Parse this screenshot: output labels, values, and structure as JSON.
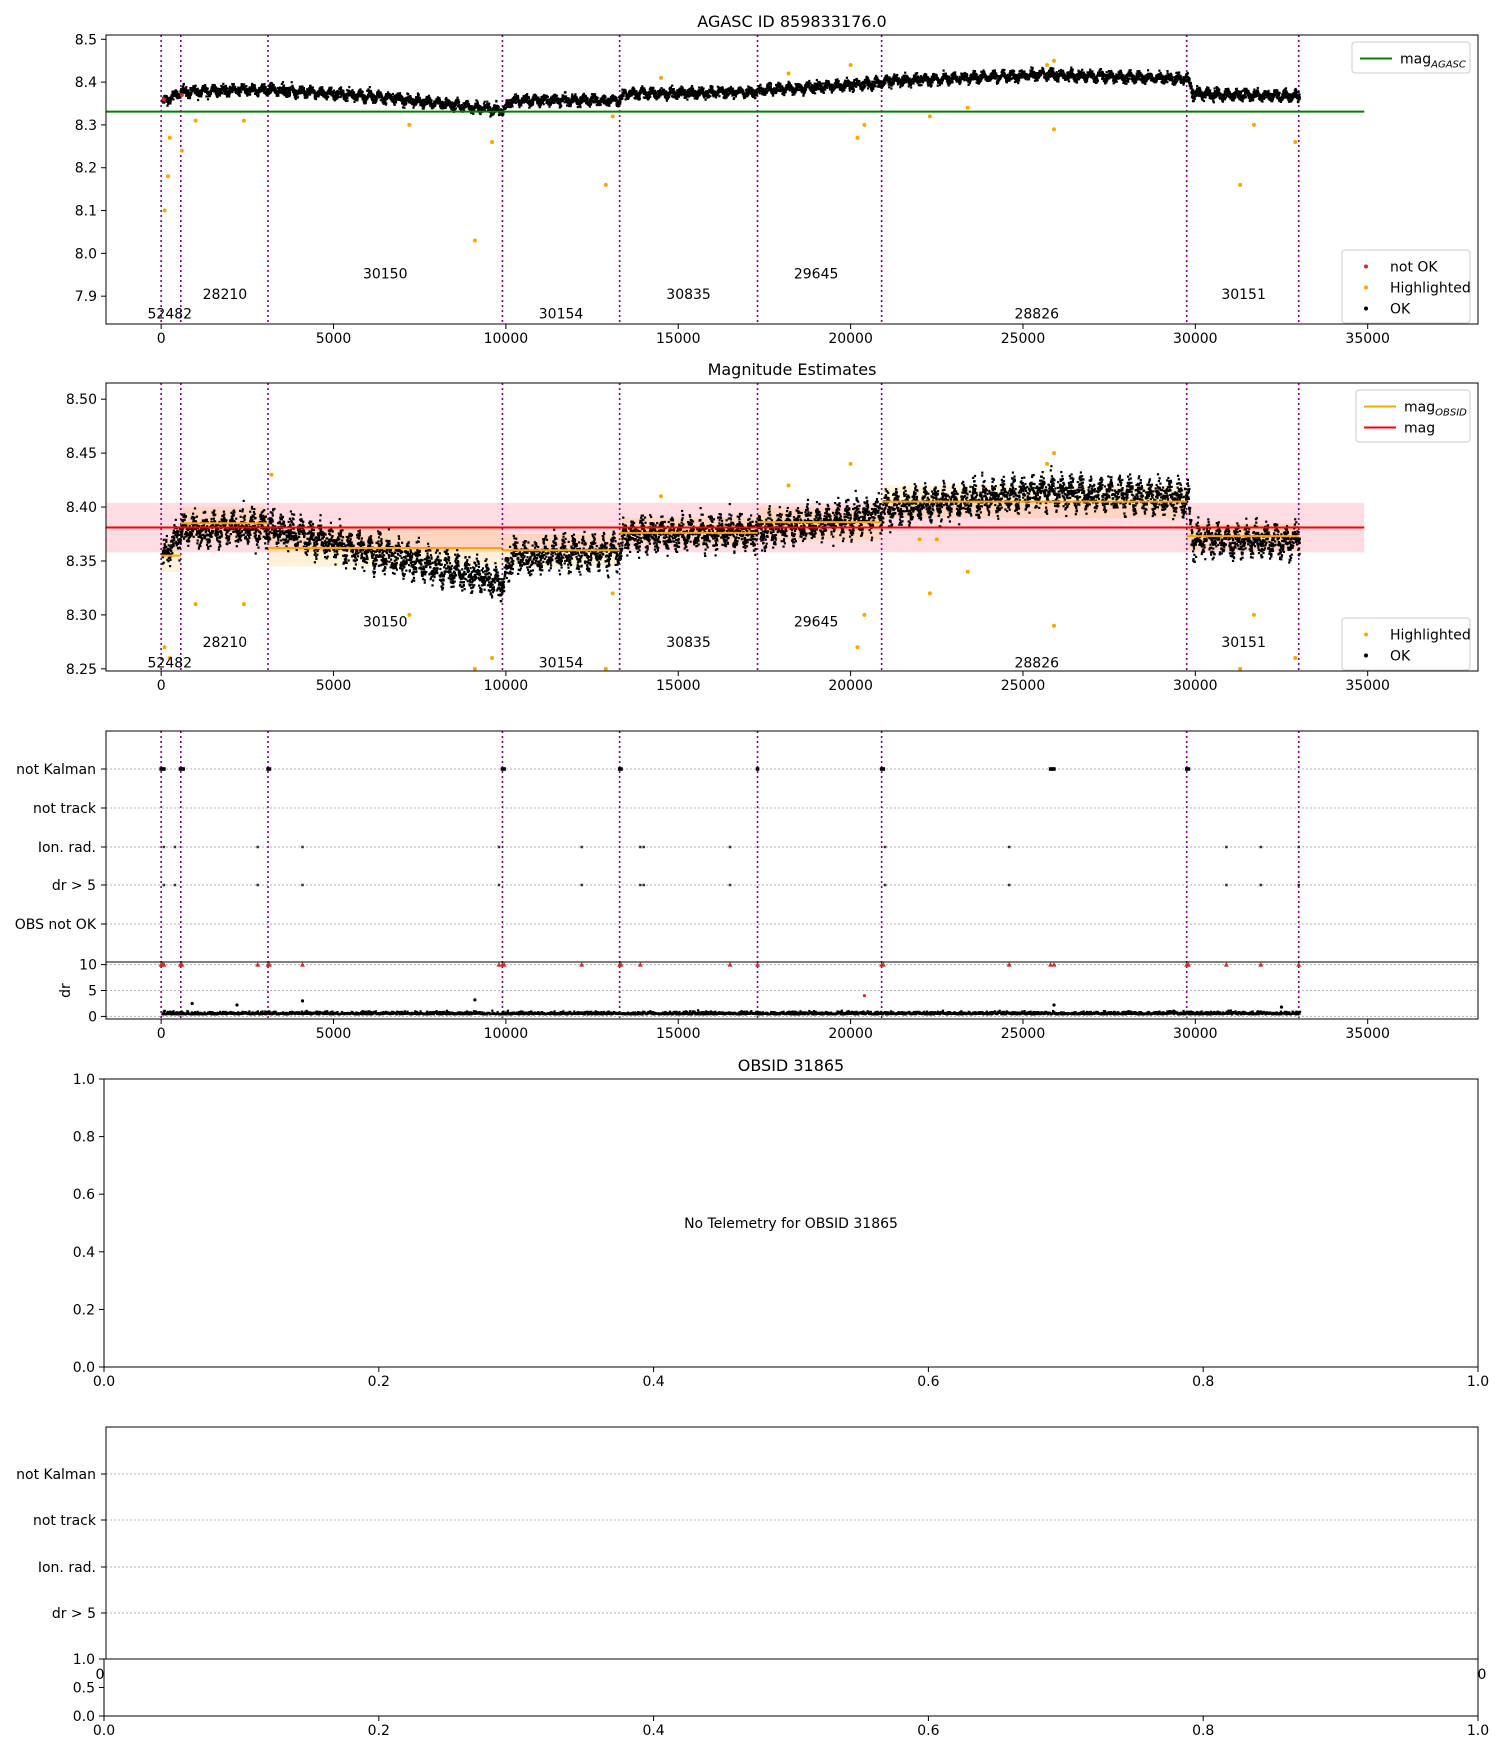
{
  "colors": {
    "ok": "#000000",
    "highlighted": "#ffa500",
    "not_ok": "#d62728",
    "agasc_line": "#008000",
    "mag_line": "#ff0000",
    "obsid_line": "#ffa500",
    "divider": "#800080",
    "band": "#ffc0cb",
    "grid": "#b0b0b0"
  },
  "chart_data": [
    {
      "id": "panel1",
      "type": "scatter",
      "title": "AGASC ID 859833176.0",
      "xlim": [
        -1600,
        38200
      ],
      "ylim": [
        7.835,
        8.51
      ],
      "xticks": [
        0,
        5000,
        10000,
        15000,
        20000,
        25000,
        30000,
        35000
      ],
      "xtick_labels": [
        "0",
        "5000",
        "10000",
        "15000",
        "20000",
        "25000",
        "30000",
        "35000"
      ],
      "yticks": [
        7.9,
        8.0,
        8.1,
        8.2,
        8.3,
        8.4,
        8.5
      ],
      "ytick_labels": [
        "7.9",
        "8.0",
        "8.1",
        "8.2",
        "8.3",
        "8.4",
        "8.5"
      ],
      "legend_top": {
        "position": "top-right",
        "entries": [
          {
            "label": "mag",
            "sub": "AGASC",
            "kind": "line",
            "color_key": "agasc_line"
          }
        ]
      },
      "legend_bottom": {
        "position": "bottom-right",
        "entries": [
          {
            "label": "not OK",
            "kind": "dot",
            "color_key": "not_ok"
          },
          {
            "label": "Highlighted",
            "kind": "dot",
            "color_key": "highlighted"
          },
          {
            "label": "OK",
            "kind": "dot",
            "color_key": "ok"
          }
        ]
      },
      "mag_agasc": 8.331,
      "mag_agasc_xrange": [
        -1600,
        34900
      ],
      "obs_boundaries": [
        0,
        570,
        3100,
        9900,
        13300,
        17300,
        20900,
        29750,
        33000
      ],
      "obs_labels": [
        {
          "text": "52482",
          "x": 250,
          "y": 7.86
        },
        {
          "text": "28210",
          "x": 1850,
          "y": 7.905
        },
        {
          "text": "30150",
          "x": 6500,
          "y": 7.953
        },
        {
          "text": "30154",
          "x": 11600,
          "y": 7.86
        },
        {
          "text": "30835",
          "x": 15300,
          "y": 7.905
        },
        {
          "text": "29645",
          "x": 19000,
          "y": 7.953
        },
        {
          "text": "28826",
          "x": 25400,
          "y": 7.86
        },
        {
          "text": "30151",
          "x": 31400,
          "y": 7.905
        }
      ],
      "trend": [
        [
          0,
          8.355
        ],
        [
          570,
          8.38
        ],
        [
          3100,
          8.385
        ],
        [
          6000,
          8.37
        ],
        [
          9500,
          8.34
        ],
        [
          9900,
          8.335
        ],
        [
          10100,
          8.36
        ],
        [
          13300,
          8.36
        ],
        [
          13400,
          8.375
        ],
        [
          17300,
          8.38
        ],
        [
          17500,
          8.385
        ],
        [
          20900,
          8.4
        ],
        [
          21000,
          8.405
        ],
        [
          25500,
          8.42
        ],
        [
          29750,
          8.41
        ],
        [
          29900,
          8.375
        ],
        [
          33000,
          8.37
        ]
      ],
      "highlighted_points": [
        [
          100,
          8.1
        ],
        [
          200,
          8.18
        ],
        [
          250,
          8.27
        ],
        [
          600,
          8.24
        ],
        [
          1000,
          8.31
        ],
        [
          2400,
          8.31
        ],
        [
          7200,
          8.3
        ],
        [
          9100,
          8.03
        ],
        [
          9600,
          8.26
        ],
        [
          12900,
          8.16
        ],
        [
          13100,
          8.32
        ],
        [
          20200,
          8.27
        ],
        [
          20400,
          8.3
        ],
        [
          22300,
          8.32
        ],
        [
          23400,
          8.34
        ],
        [
          25900,
          8.29
        ],
        [
          31300,
          8.16
        ],
        [
          31700,
          8.3
        ],
        [
          32900,
          8.26
        ],
        [
          25900,
          8.45
        ],
        [
          25700,
          8.44
        ],
        [
          20000,
          8.44
        ],
        [
          14500,
          8.41
        ],
        [
          18200,
          8.42
        ]
      ],
      "not_ok_points": [
        [
          80,
          8.36
        ],
        [
          600,
          8.37
        ]
      ],
      "spread": 0.018
    },
    {
      "id": "panel2",
      "type": "scatter",
      "title": "Magnitude Estimates",
      "xlim": [
        -1600,
        38200
      ],
      "ylim": [
        8.248,
        8.515
      ],
      "xticks": [
        0,
        5000,
        10000,
        15000,
        20000,
        25000,
        30000,
        35000
      ],
      "xtick_labels": [
        "0",
        "5000",
        "10000",
        "15000",
        "20000",
        "25000",
        "30000",
        "35000"
      ],
      "yticks": [
        8.25,
        8.3,
        8.35,
        8.4,
        8.45,
        8.5
      ],
      "ytick_labels": [
        "8.25",
        "8.30",
        "8.35",
        "8.40",
        "8.45",
        "8.50"
      ],
      "legend_top": {
        "position": "top-right",
        "entries": [
          {
            "label": "mag",
            "sub": "OBSID",
            "kind": "line",
            "color_key": "obsid_line"
          },
          {
            "label": "mag",
            "sub": "",
            "kind": "line",
            "color_key": "mag_line"
          }
        ]
      },
      "legend_bottom": {
        "position": "bottom-right",
        "entries": [
          {
            "label": "Highlighted",
            "kind": "dot",
            "color_key": "highlighted"
          },
          {
            "label": "OK",
            "kind": "dot",
            "color_key": "ok"
          }
        ]
      },
      "mag": 8.381,
      "mag_band": [
        8.358,
        8.404
      ],
      "mag_xrange": [
        -1600,
        34900
      ],
      "obsid_mags": [
        {
          "x0": 0,
          "x1": 570,
          "mag": 8.355,
          "band": [
            8.34,
            8.37
          ]
        },
        {
          "x0": 570,
          "x1": 3100,
          "mag": 8.385,
          "band": [
            8.37,
            8.4
          ]
        },
        {
          "x0": 3100,
          "x1": 9900,
          "mag": 8.362,
          "band": [
            8.345,
            8.38
          ]
        },
        {
          "x0": 9900,
          "x1": 13300,
          "mag": 8.36,
          "band": [
            8.345,
            8.375
          ]
        },
        {
          "x0": 13300,
          "x1": 17300,
          "mag": 8.376,
          "band": [
            8.365,
            8.39
          ]
        },
        {
          "x0": 17300,
          "x1": 20900,
          "mag": 8.386,
          "band": [
            8.37,
            8.4
          ]
        },
        {
          "x0": 20900,
          "x1": 29750,
          "mag": 8.405,
          "band": [
            8.39,
            8.42
          ]
        },
        {
          "x0": 29750,
          "x1": 33000,
          "mag": 8.373,
          "band": [
            8.36,
            8.385
          ]
        }
      ],
      "obs_boundaries": [
        0,
        570,
        3100,
        9900,
        13300,
        17300,
        20900,
        29750,
        33000
      ],
      "obs_labels": [
        {
          "text": "52482",
          "x": 250,
          "y": 8.256
        },
        {
          "text": "28210",
          "x": 1850,
          "y": 8.275
        },
        {
          "text": "30150",
          "x": 6500,
          "y": 8.294
        },
        {
          "text": "30154",
          "x": 11600,
          "y": 8.256
        },
        {
          "text": "30835",
          "x": 15300,
          "y": 8.275
        },
        {
          "text": "29645",
          "x": 19000,
          "y": 8.294
        },
        {
          "text": "28826",
          "x": 25400,
          "y": 8.256
        },
        {
          "text": "30151",
          "x": 31400,
          "y": 8.275
        }
      ],
      "trend": [
        [
          0,
          8.355
        ],
        [
          570,
          8.38
        ],
        [
          3100,
          8.382
        ],
        [
          6000,
          8.36
        ],
        [
          9500,
          8.335
        ],
        [
          9900,
          8.33
        ],
        [
          10100,
          8.355
        ],
        [
          13300,
          8.36
        ],
        [
          13400,
          8.375
        ],
        [
          17300,
          8.378
        ],
        [
          17500,
          8.38
        ],
        [
          20900,
          8.395
        ],
        [
          21000,
          8.4
        ],
        [
          25500,
          8.415
        ],
        [
          29750,
          8.41
        ],
        [
          29900,
          8.37
        ],
        [
          33000,
          8.37
        ]
      ],
      "highlighted_points": [
        [
          100,
          8.27
        ],
        [
          250,
          8.26
        ],
        [
          1000,
          8.31
        ],
        [
          2400,
          8.31
        ],
        [
          7200,
          8.3
        ],
        [
          9100,
          8.25
        ],
        [
          9600,
          8.26
        ],
        [
          12900,
          8.25
        ],
        [
          13100,
          8.32
        ],
        [
          20200,
          8.27
        ],
        [
          20400,
          8.3
        ],
        [
          22300,
          8.32
        ],
        [
          23400,
          8.34
        ],
        [
          25900,
          8.29
        ],
        [
          31300,
          8.25
        ],
        [
          31700,
          8.3
        ],
        [
          32900,
          8.26
        ],
        [
          25900,
          8.45
        ],
        [
          25700,
          8.44
        ],
        [
          20000,
          8.44
        ],
        [
          14500,
          8.41
        ],
        [
          18200,
          8.42
        ],
        [
          22000,
          8.37
        ],
        [
          22500,
          8.37
        ],
        [
          3200,
          8.43
        ]
      ],
      "spread": 0.022
    },
    {
      "id": "panel3",
      "type": "scatter",
      "title": "",
      "xlim": [
        -1600,
        38200
      ],
      "xticks": [
        0,
        5000,
        10000,
        15000,
        20000,
        25000,
        30000,
        35000
      ],
      "xtick_labels": [
        "0",
        "5000",
        "10000",
        "15000",
        "20000",
        "25000",
        "30000",
        "35000"
      ],
      "flag_rows": [
        "not Kalman",
        "not track",
        "Ion. rad.",
        "dr > 5",
        "OBS not OK"
      ],
      "flag_points": {
        "not Kalman": [
          0,
          40,
          80,
          560,
          600,
          640,
          3100,
          3140,
          9900,
          9950,
          13300,
          13340,
          17300,
          20900,
          20950,
          25800,
          25850,
          25900,
          29750,
          29800
        ],
        "not track": [],
        "Ion. rad.": [
          80,
          400,
          2800,
          4100,
          9800,
          12200,
          13900,
          14000,
          16500,
          21000,
          24600,
          30900,
          31900,
          33000
        ],
        "dr > 5": [
          80,
          400,
          2800,
          4100,
          9800,
          12200,
          13900,
          14000,
          16500,
          21000,
          24600,
          30900,
          31900,
          33000
        ],
        "OBS not OK": []
      },
      "dr_ylabel": "dr",
      "dr_ylim": [
        -0.5,
        10.5
      ],
      "dr_yticks": [
        0,
        5,
        10
      ],
      "dr_ytick_labels": [
        "0",
        "5",
        "10"
      ],
      "dr_typical": 0.6,
      "dr_outliers": [
        [
          0,
          10
        ],
        [
          40,
          10
        ],
        [
          80,
          10
        ],
        [
          560,
          10
        ],
        [
          600,
          10
        ],
        [
          2800,
          10
        ],
        [
          3100,
          10
        ],
        [
          3140,
          10
        ],
        [
          4100,
          10
        ],
        [
          9800,
          10
        ],
        [
          9900,
          10
        ],
        [
          9950,
          10
        ],
        [
          12200,
          10
        ],
        [
          13300,
          10
        ],
        [
          13340,
          10
        ],
        [
          13900,
          10
        ],
        [
          16500,
          10
        ],
        [
          17300,
          10
        ],
        [
          20900,
          10
        ],
        [
          20950,
          10
        ],
        [
          24600,
          10
        ],
        [
          25800,
          10
        ],
        [
          25900,
          10
        ],
        [
          29750,
          10
        ],
        [
          29800,
          10
        ],
        [
          30900,
          10
        ],
        [
          31900,
          10
        ],
        [
          33000,
          10
        ],
        [
          900,
          2.5
        ],
        [
          2200,
          2.2
        ],
        [
          4100,
          3
        ],
        [
          9100,
          3.2
        ],
        [
          20400,
          4
        ],
        [
          25900,
          2.2
        ],
        [
          32500,
          1.8
        ]
      ],
      "obs_boundaries": [
        0,
        570,
        3100,
        9900,
        13300,
        17300,
        20900,
        29750,
        33000
      ]
    },
    {
      "id": "panel4",
      "type": "scatter",
      "title": "OBSID 31865",
      "xlim": [
        0,
        1
      ],
      "ylim": [
        0,
        1
      ],
      "xticks": [
        0,
        0.2,
        0.4,
        0.6,
        0.8,
        1.0
      ],
      "xtick_labels": [
        "0.0",
        "0.2",
        "0.4",
        "0.6",
        "0.8",
        "1.0"
      ],
      "yticks": [
        0,
        0.2,
        0.4,
        0.6,
        0.8,
        1.0
      ],
      "ytick_labels": [
        "0.0",
        "0.2",
        "0.4",
        "0.6",
        "0.8",
        "1.0"
      ],
      "message": "No Telemetry for OBSID 31865"
    },
    {
      "id": "panel5",
      "type": "scatter",
      "title": "",
      "flag_rows": [
        "not Kalman",
        "not track",
        "Ion. rad.",
        "dr > 5"
      ],
      "overlap_tick_left": "0",
      "overlap_tick_right": "0",
      "sub_ylim": [
        0,
        1
      ],
      "sub_yticks": [
        0,
        0.5,
        1.0
      ],
      "sub_ytick_labels": [
        "0.0",
        "0.5",
        "1.0"
      ],
      "xticks": [
        0,
        0.2,
        0.4,
        0.6,
        0.8,
        1.0
      ],
      "xtick_labels": [
        "0.0",
        "0.2",
        "0.4",
        "0.6",
        "0.8",
        "1.0"
      ]
    }
  ]
}
